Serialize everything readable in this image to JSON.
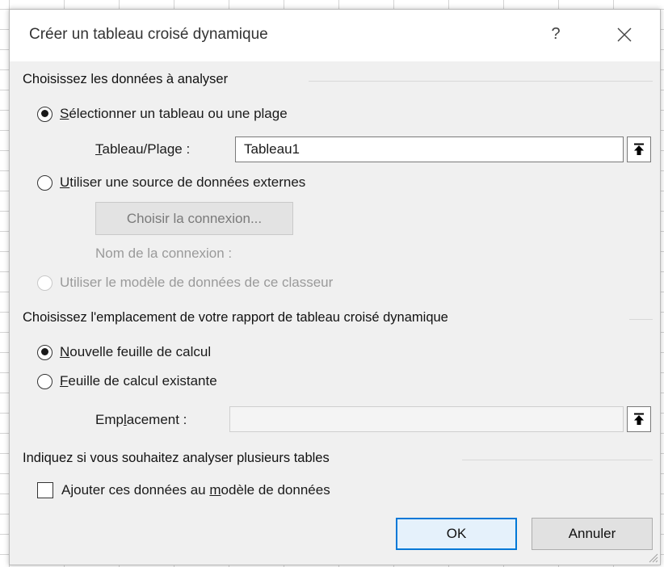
{
  "dialog": {
    "title": "Créer un tableau croisé dynamique",
    "help_label": "?"
  },
  "section1": {
    "title": "Choisissez les données à analyser",
    "option_range": {
      "accel": "S",
      "rest": "électionner un tableau ou une plage",
      "checked": true
    },
    "range_field": {
      "accel": "T",
      "rest": "ableau/Plage :",
      "value": "Tableau1"
    },
    "option_external": {
      "accel": "U",
      "rest": "tiliser une source de données externes",
      "checked": false
    },
    "choose_connection_label": "Choisir la connexion...",
    "connection_name_label": "Nom de la connexion :",
    "option_datamodel": {
      "label": "Utiliser le modèle de données de ce classeur",
      "enabled": false
    }
  },
  "section2": {
    "title": "Choisissez l'emplacement de votre rapport de tableau croisé dynamique",
    "option_new_sheet": {
      "accel": "N",
      "rest": "ouvelle feuille de calcul",
      "checked": true
    },
    "option_existing": {
      "accel": "F",
      "rest": "euille de calcul existante",
      "checked": false
    },
    "location_field": {
      "pre": "Emp",
      "accel": "l",
      "post": "acement :",
      "value": ""
    }
  },
  "section3": {
    "title": "Indiquez si vous souhaitez analyser plusieurs tables",
    "checkbox": {
      "pre": "Ajouter ces données au ",
      "accel": "m",
      "post": "odèle de données",
      "checked": false
    }
  },
  "buttons": {
    "ok_label": "OK",
    "cancel_label": "Annuler"
  },
  "colors": {
    "dialog_bg": "#f0f0f0",
    "primary_border": "#0078d7"
  },
  "icons": [
    "close-icon",
    "collapse-dialog-icon",
    "resize-grip-icon"
  ]
}
